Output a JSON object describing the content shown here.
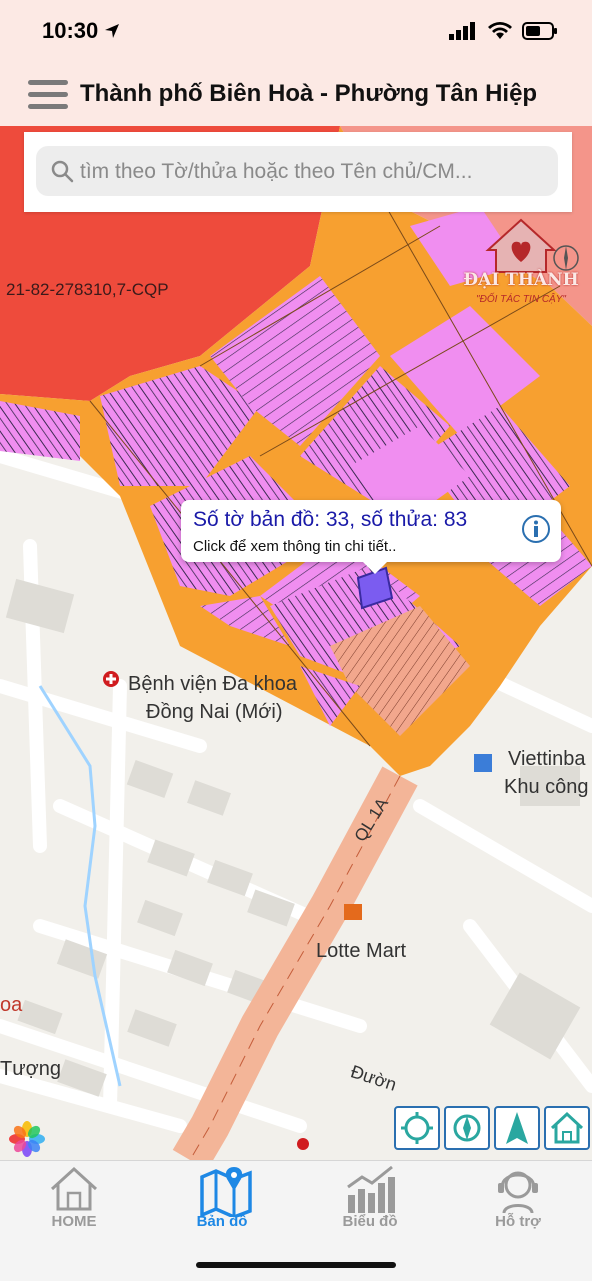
{
  "status": {
    "time": "10:30"
  },
  "header": {
    "title": "Thành phố Biên Hoà - Phường Tân Hiệp"
  },
  "search": {
    "placeholder": "tìm theo Tờ/thửa hoặc theo Tên chủ/CM..."
  },
  "popup": {
    "title": "Số tờ bản đồ: 33, số thửa: 83",
    "subtitle": "Click để xem thông tin chi tiết.."
  },
  "logo": {
    "name": "ĐẠI THÀNH",
    "slogan": "\"ĐỐI TÁC TIN CẬY\""
  },
  "map_labels": {
    "parcel_code": "21-82-278310,7-CQP",
    "hospital_line1": "Bệnh viện Đa khoa",
    "hospital_line2": "Đồng Nai (Mới)",
    "viettin_line1": "Viettinba",
    "viettin_line2": "Khu công",
    "highway": "QL 1A",
    "lotte": "Lotte Mart",
    "left_oa": "oa",
    "tuong": "Tượng",
    "duong": "Đườn"
  },
  "map_controls": [
    {
      "icon": "locate-icon"
    },
    {
      "icon": "compass-icon"
    },
    {
      "icon": "navigate-icon"
    },
    {
      "icon": "home-map-icon"
    }
  ],
  "tabs": [
    {
      "label": "HOME",
      "icon": "home-icon",
      "active": false
    },
    {
      "label": "Bản đồ",
      "icon": "map-icon",
      "active": true
    },
    {
      "label": "Biểu đồ",
      "icon": "chart-icon",
      "active": false
    },
    {
      "label": "Hỗ trợ",
      "icon": "support-icon",
      "active": false
    }
  ],
  "colors": {
    "header_bg": "#fce9e4",
    "active_tab": "#1e88e5",
    "inactive_tab": "#9a9a9a",
    "popup_title": "#1a1aa8",
    "zone_red": "#ee4b3c",
    "zone_orange": "#f7a030",
    "zone_pink": "#f08ef0",
    "highway": "#f5b79b"
  }
}
